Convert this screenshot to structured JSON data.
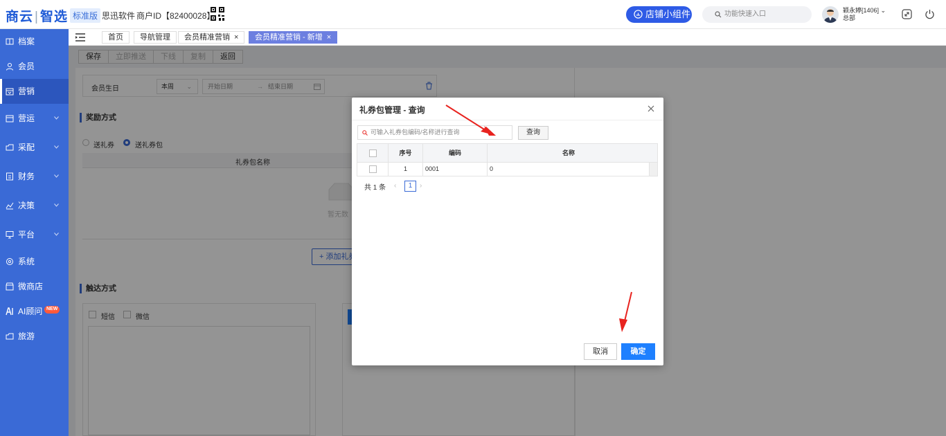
{
  "header": {
    "logo_left": "商云",
    "logo_right": "智选",
    "edition": "标准版",
    "company": "思迅软件",
    "merchant_id": "商户ID【82400028】",
    "widget_button": "店铺小组件",
    "search_placeholder": "功能快速入口",
    "user_name": "颖永婷[1406]",
    "user_dept": "总部"
  },
  "sidebar": {
    "items": [
      {
        "label": "档案",
        "icon": "archive-icon"
      },
      {
        "label": "会员",
        "icon": "user-icon"
      },
      {
        "label": "营销",
        "icon": "marketing-icon",
        "active": true
      },
      {
        "label": "营运",
        "icon": "operation-icon"
      },
      {
        "label": "采配",
        "icon": "purchase-icon"
      },
      {
        "label": "财务",
        "icon": "finance-icon"
      },
      {
        "label": "决策",
        "icon": "decision-icon"
      },
      {
        "label": "平台",
        "icon": "platform-icon"
      },
      {
        "label": "系统",
        "icon": "system-icon"
      },
      {
        "label": "微商店",
        "icon": "shop-icon"
      },
      {
        "label": "AI顾问",
        "icon": "ai-icon",
        "badge": "NEW"
      },
      {
        "label": "旅游",
        "icon": "travel-icon"
      }
    ]
  },
  "tabs": [
    {
      "label": "首页"
    },
    {
      "label": "导航管理"
    },
    {
      "label": "会员精准营销",
      "closable": "×"
    },
    {
      "label": "会员精准营销 - 新增",
      "closable": "×",
      "active": true
    }
  ],
  "toolbar": {
    "save": "保存",
    "push_now": "立即推送",
    "offline": "下线",
    "copy": "复制",
    "back": "返回"
  },
  "form": {
    "birthday_label": "会员生日",
    "birthday_range": "本周",
    "start_placeholder": "开始日期",
    "end_placeholder": "结束日期",
    "reward_title": "奖励方式",
    "reward_coupon": "送礼券",
    "reward_package": "送礼券包",
    "package_column": "礼券包名称",
    "empty_text": "暂无数",
    "add_button": "+ 添加礼券",
    "reach_title": "触达方式",
    "sms": "短信",
    "wechat": "微信"
  },
  "dialog": {
    "title": "礼券包管理 - 查询",
    "search_placeholder": "可输入礼券包编码/名称进行查询",
    "query_button": "查询",
    "columns": {
      "index": "序号",
      "code": "编码",
      "name": "名称"
    },
    "rows": [
      {
        "index": "1",
        "code": "0001",
        "name": "0"
      }
    ],
    "total": "共 1 条",
    "page_prev": "‹",
    "page": "1",
    "page_next": "›",
    "cancel": "取消",
    "confirm": "确定"
  },
  "colors": {
    "brand": "#3a6ad6",
    "primary_button": "#1e80ff",
    "annotation_arrow": "#e8231f"
  }
}
